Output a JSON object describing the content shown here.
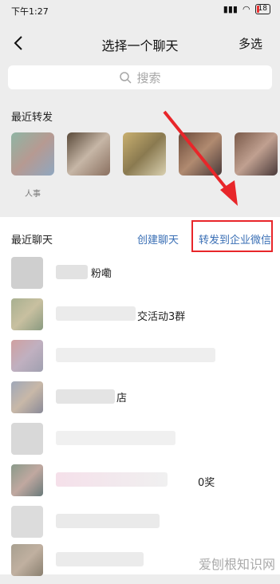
{
  "status": {
    "time": "下午1:27",
    "battery": "18"
  },
  "header": {
    "title": "选择一个聊天",
    "multi_select": "多选"
  },
  "search": {
    "placeholder": "搜索"
  },
  "recent_forward": {
    "label": "最近转发",
    "contacts": [
      {
        "name": "人事"
      },
      {
        "name": ""
      },
      {
        "name": ""
      },
      {
        "name": ""
      },
      {
        "name": ""
      }
    ]
  },
  "recent_chats": {
    "label": "最近聊天",
    "create_chat": "创建聊天",
    "forward_enterprise": "转发到企业微信",
    "rows": [
      {
        "fragment": "粉嘞"
      },
      {
        "fragment": "交活动3群"
      },
      {
        "fragment": ""
      },
      {
        "fragment": "店"
      },
      {
        "fragment": ""
      },
      {
        "fragment": "0奖"
      },
      {
        "fragment": ""
      },
      {
        "fragment": ""
      }
    ]
  },
  "annotation": {
    "arrow_color": "#e8262a",
    "box_color": "#e8262a"
  },
  "watermark": "爱刨根知识网"
}
